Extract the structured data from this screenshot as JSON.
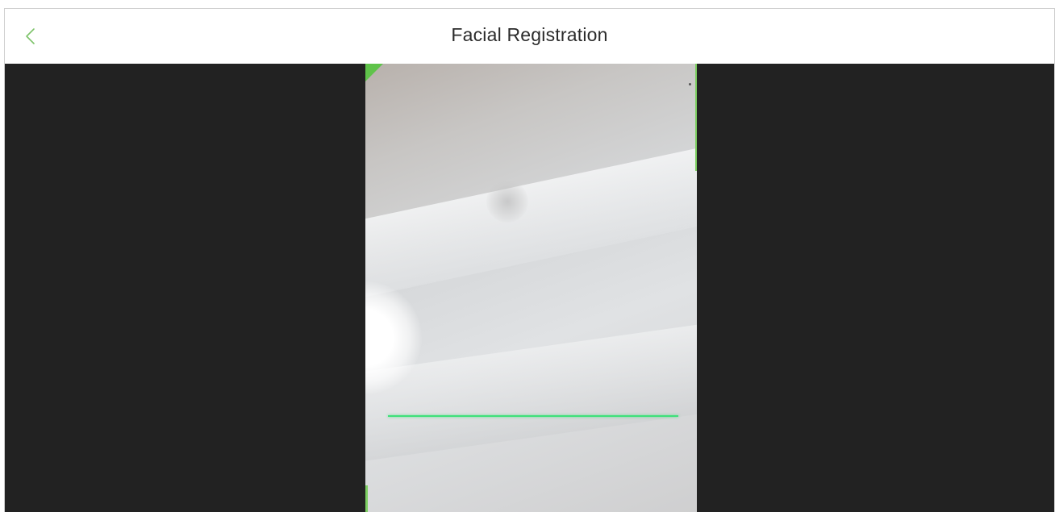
{
  "header": {
    "title": "Facial Registration",
    "back_icon": "chevron-left-icon"
  },
  "colors": {
    "accent": "#5fc34a",
    "scan_line": "#3fe07a",
    "camera_background": "#222222",
    "header_background": "#ffffff"
  }
}
